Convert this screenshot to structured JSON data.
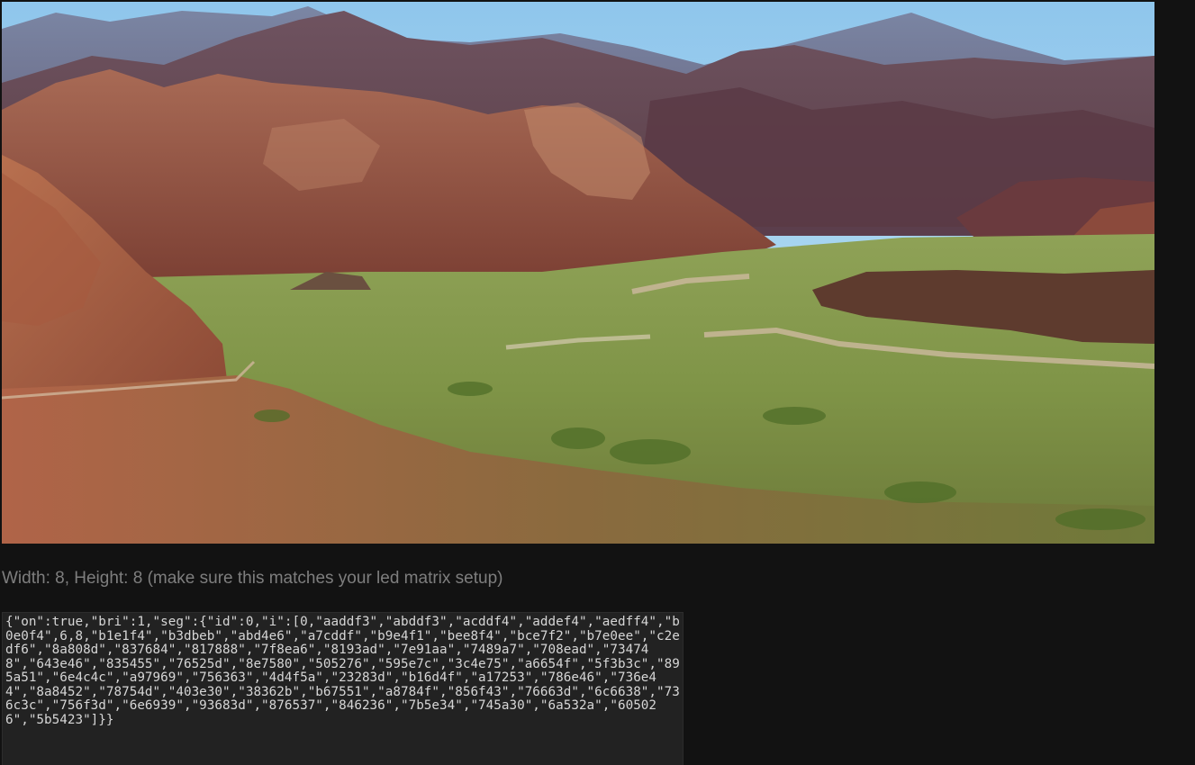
{
  "image": {
    "description_icon": "landscape-photo"
  },
  "dimensions_text": "Width: 8, Height: 8 (make sure this matches your led matrix setup)",
  "json_output": "{\"on\":true,\"bri\":1,\"seg\":{\"id\":0,\"i\":[0,\"aaddf3\",\"abddf3\",\"acddf4\",\"addef4\",\"aedff4\",\"b0e0f4\",6,8,\"b1e1f4\",\"b3dbeb\",\"abd4e6\",\"a7cddf\",\"b9e4f1\",\"bee8f4\",\"bce7f2\",\"b7e0ee\",\"c2edf6\",\"8a808d\",\"837684\",\"817888\",\"7f8ea6\",\"8193ad\",\"7e91aa\",\"7489a7\",\"708ead\",\"734748\",\"643e46\",\"835455\",\"76525d\",\"8e7580\",\"505276\",\"595e7c\",\"3c4e75\",\"a6654f\",\"5f3b3c\",\"895a51\",\"6e4c4c\",\"a97969\",\"756363\",\"4d4f5a\",\"23283d\",\"b16d4f\",\"a17253\",\"786e46\",\"736e44\",\"8a8452\",\"78754d\",\"403e30\",\"38362b\",\"b67551\",\"a8784f\",\"856f43\",\"76663d\",\"6c6638\",\"736c3c\",\"756f3d\",\"6e6939\",\"93683d\",\"876537\",\"846236\",\"7b5e34\",\"745a30\",\"6a532a\",\"605026\",\"5b5423\"]}}",
  "colors": {
    "page_background": "#121212",
    "dims_text": "#7e7e7e",
    "code_background": "#222222",
    "code_text": "#d6d6d6"
  }
}
